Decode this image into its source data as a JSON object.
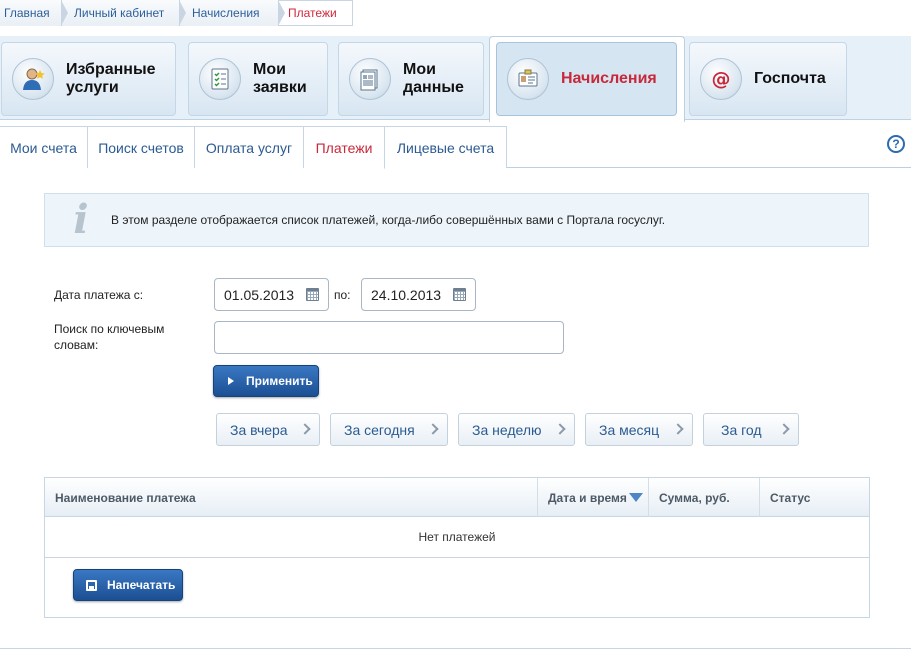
{
  "breadcrumbs": [
    "Главная",
    "Личный кабинет",
    "Начисления",
    "Платежи"
  ],
  "main_tabs": [
    {
      "label": "Избранные\nуслуги",
      "icon": "user-star-icon"
    },
    {
      "label": "Мои\nзаявки",
      "icon": "checklist-icon"
    },
    {
      "label": "Мои\nданные",
      "icon": "document-icon"
    },
    {
      "label": "Начисления",
      "icon": "id-card-icon",
      "active": true
    },
    {
      "label": "Госпочта",
      "icon": "at-mail-icon"
    }
  ],
  "sub_tabs": [
    {
      "label": "Мои счета"
    },
    {
      "label": "Поиск счетов"
    },
    {
      "label": "Оплата услуг"
    },
    {
      "label": "Платежи",
      "active": true
    },
    {
      "label": "Лицевые счета"
    }
  ],
  "help_symbol": "?",
  "info": {
    "text": "В этом разделе отображается список платежей, когда-либо совершённых вами с Портала госуслуг.",
    "icon_glyph": "i"
  },
  "form": {
    "date_from_label": "Дата платежа с:",
    "date_from": "01.05.2013",
    "date_to_label": "по:",
    "date_to": "24.10.2013",
    "keywords_label": "Поиск по ключевым\nсловам:",
    "keywords_value": "",
    "apply_label": "Применить"
  },
  "quick_filters": [
    "За вчера",
    "За сегодня",
    "За неделю",
    "За месяц",
    "За год"
  ],
  "table": {
    "columns": [
      "Наименование платежа",
      "Дата и время",
      "Сумма, руб.",
      "Статус"
    ],
    "empty_text": "Нет платежей",
    "print_label": "Напечатать"
  },
  "colors": {
    "accent_red": "#c8283a",
    "link_blue": "#2b5b92",
    "button_blue": "#1c4f93"
  }
}
